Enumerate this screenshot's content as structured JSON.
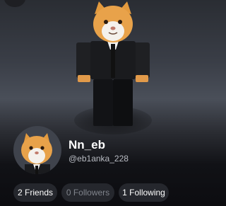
{
  "profile": {
    "display_name": "Nn_eb",
    "username": "@eb1anka_228"
  },
  "stats": {
    "friends": "2 Friends",
    "followers": "0 Followers",
    "following": "1 Following"
  },
  "icons": {
    "back": "back-button-icon"
  },
  "colors": {
    "background": "#0b0b0f",
    "pill": "#25272d",
    "text": "#ffffff",
    "muted": "#b9bcc3"
  }
}
